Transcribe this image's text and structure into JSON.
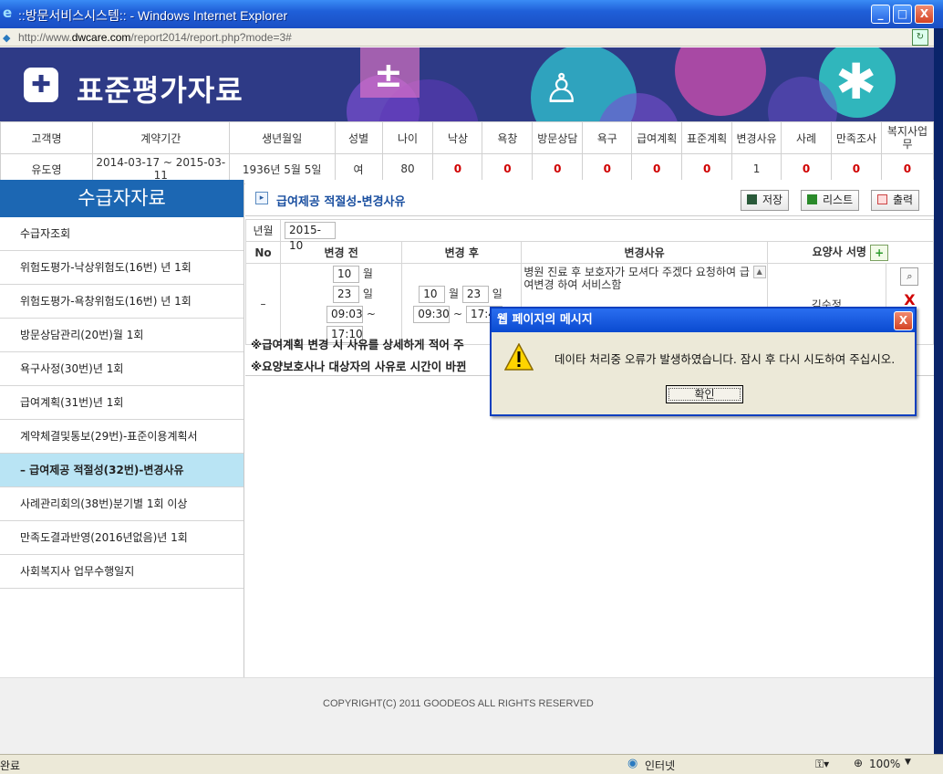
{
  "window": {
    "title": "::방문서비스시스템:: - Windows Internet Explorer",
    "minimize": "_",
    "maximize": "□",
    "close": "X"
  },
  "address": {
    "url_prefix": "http://www.",
    "url_domain": "dwcare.com",
    "url_path": "/report2014/report.php?mode=3#"
  },
  "banner": {
    "title": "표준평가자료",
    "logo_glyph": "✚"
  },
  "info": {
    "headers": [
      "고객명",
      "계약기간",
      "생년월일",
      "성별",
      "나이",
      "낙상",
      "욕창",
      "방문상담",
      "욕구",
      "급여계획",
      "표준계획",
      "변경사유",
      "사례",
      "만족조사",
      "복지사업무"
    ],
    "values": [
      "유도영",
      "2014-03-17 ~ 2015-03-11",
      "1936년 5월 5일",
      "여",
      "80",
      "0",
      "0",
      "0",
      "0",
      "0",
      "0",
      "1",
      "0",
      "0",
      "0"
    ]
  },
  "sidebar": {
    "heading": "수급자자료",
    "items": [
      {
        "label": "수급자조회"
      },
      {
        "label": "위험도평가-낙상위험도(16번) 년 1회"
      },
      {
        "label": "위험도평가-욕창위험도(16번) 년 1회"
      },
      {
        "label": "방문상담관리(20번)월 1회"
      },
      {
        "label": "욕구사정(30번)년 1회"
      },
      {
        "label": "급여계획(31번)년 1회"
      },
      {
        "label": "계약체결및통보(29번)-표준이용계획서"
      },
      {
        "label": "– 급여제공 적절성(32번)-변경사유"
      },
      {
        "label": "사례관리회의(38번)분기별 1회 이상"
      },
      {
        "label": "만족도결과반영(2016년없음)년 1회"
      },
      {
        "label": "사회복지사 업무수행일지"
      }
    ],
    "active_index": 7
  },
  "section": {
    "title": "급여제공 적절성-변경사유",
    "save": "저장",
    "list": "리스트",
    "print": "출력"
  },
  "grid": {
    "period_label": "년월",
    "period_value": "2015-10",
    "headers": {
      "no": "No",
      "before": "변경 전",
      "after": "변경 후",
      "reason": "변경사유",
      "signer": "요양사 서명"
    },
    "add_btn": "+",
    "row": {
      "no": "–",
      "before_month": "10",
      "before_day": "23",
      "before_start": "09:03",
      "before_end": "17:10",
      "after_month": "10",
      "after_day": "23",
      "after_start": "09:30",
      "after_end": "17:40",
      "month_unit": "월",
      "day_unit": "일",
      "tilde": "~",
      "reason": "병원 진료 후 보호자가 모셔다 주겠다 요청하여 급여변경 하여 서비스함",
      "signer": "김순정",
      "search_icon": "🔍",
      "delete_icon": "X"
    }
  },
  "notes": [
    "※급여계획 변경 시 사유를 상세하게 적어 주",
    "※요양보호사나 대상자의 사유로 시간이 바뀐"
  ],
  "footer": {
    "copyright": "COPYRIGHT(C) 2011 GOODEOS ALL RIGHTS RESERVED"
  },
  "status": {
    "left": "완료",
    "zone": "인터넷",
    "zoom": "100%"
  },
  "dialog": {
    "title": "웹 페이지의 메시지",
    "message": "데이타 처리중 오류가 발생하였습니다. 잠시 후 다시 시도하여 주십시오.",
    "ok": "확인",
    "close": "X"
  }
}
